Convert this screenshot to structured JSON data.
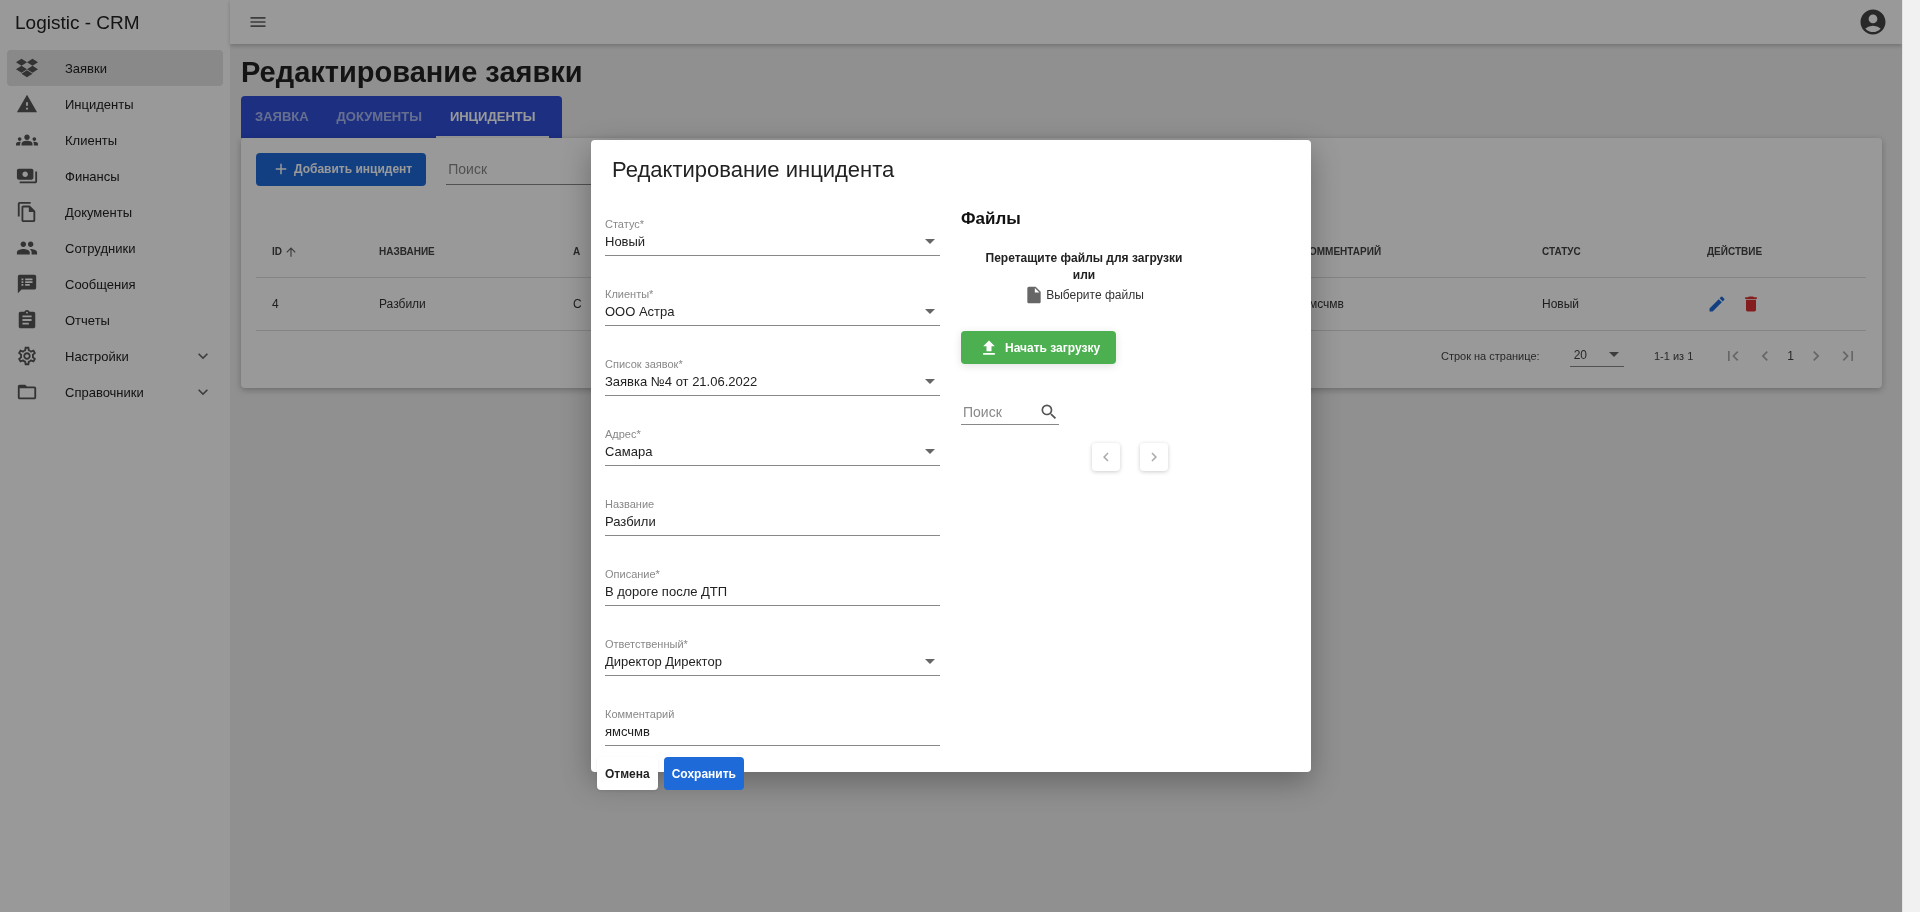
{
  "app": {
    "title": "Logistic - CRM"
  },
  "sidebar": {
    "items": [
      {
        "label": "Заявки",
        "selected": true,
        "expandable": false
      },
      {
        "label": "Инциденты",
        "selected": false,
        "expandable": false
      },
      {
        "label": "Клиенты",
        "selected": false,
        "expandable": false
      },
      {
        "label": "Финансы",
        "selected": false,
        "expandable": false
      },
      {
        "label": "Документы",
        "selected": false,
        "expandable": false
      },
      {
        "label": "Сотрудники",
        "selected": false,
        "expandable": false
      },
      {
        "label": "Сообщения",
        "selected": false,
        "expandable": false
      },
      {
        "label": "Отчеты",
        "selected": false,
        "expandable": false
      },
      {
        "label": "Настройки",
        "selected": false,
        "expandable": true
      },
      {
        "label": "Справочники",
        "selected": false,
        "expandable": true
      }
    ]
  },
  "page": {
    "title": "Редактирование заявки"
  },
  "tabs": [
    {
      "label": "ЗАЯВКА",
      "selected": false
    },
    {
      "label": "ДОКУМЕНТЫ",
      "selected": false
    },
    {
      "label": "ИНЦИДЕНТЫ",
      "selected": true
    }
  ],
  "toolbar": {
    "add_button": "Добавить инцидент",
    "search": {
      "placeholder": "Поиск"
    }
  },
  "table": {
    "columns": [
      {
        "label": "ID",
        "sorted": true
      },
      {
        "label": "НАЗВАНИЕ",
        "sorted": false
      },
      {
        "label": "А",
        "sorted": false
      },
      {
        "label": "ОММЕНТАРИЙ",
        "sorted": false
      },
      {
        "label": "СТАТУС",
        "sorted": false
      },
      {
        "label": "ДЕЙСТВИЕ",
        "sorted": false
      }
    ],
    "rows": [
      {
        "cells": [
          "4",
          "Разбили",
          "С",
          "мсчмв",
          "Новый"
        ]
      }
    ]
  },
  "pagination": {
    "rows_per_page_label": "Строк на странице:",
    "rows_per_page": "20",
    "range": "1-1 из 1",
    "page": "1"
  },
  "dialog": {
    "title": "Редактирование инцидента",
    "fields": [
      {
        "label": "Статус*",
        "value": "Новый",
        "kind": "select"
      },
      {
        "label": "Клиенты*",
        "value": "ООО Астра",
        "kind": "select"
      },
      {
        "label": "Список заявок*",
        "value": "Заявка №4 от 21.06.2022",
        "kind": "select"
      },
      {
        "label": "Адрес*",
        "value": "Самара",
        "kind": "select"
      },
      {
        "label": "Название",
        "value": "Разбили",
        "kind": "text"
      },
      {
        "label": "Описание*",
        "value": "В дороге после ДТП",
        "kind": "text"
      },
      {
        "label": "Ответственный*",
        "value": "Директор Директор",
        "kind": "select"
      },
      {
        "label": "Комментарий",
        "value": "ямсчмв",
        "kind": "text"
      }
    ],
    "files": {
      "title": "Файлы",
      "drop_text": "Перетащите файлы для загрузки",
      "or": "или",
      "choose": "Выберите файлы",
      "upload_button": "Начать загрузку",
      "search": {
        "placeholder": "Поиск"
      }
    },
    "buttons": [
      {
        "label": "Отмена",
        "kind": "text"
      },
      {
        "label": "Сохранить",
        "kind": "primary"
      }
    ]
  }
}
